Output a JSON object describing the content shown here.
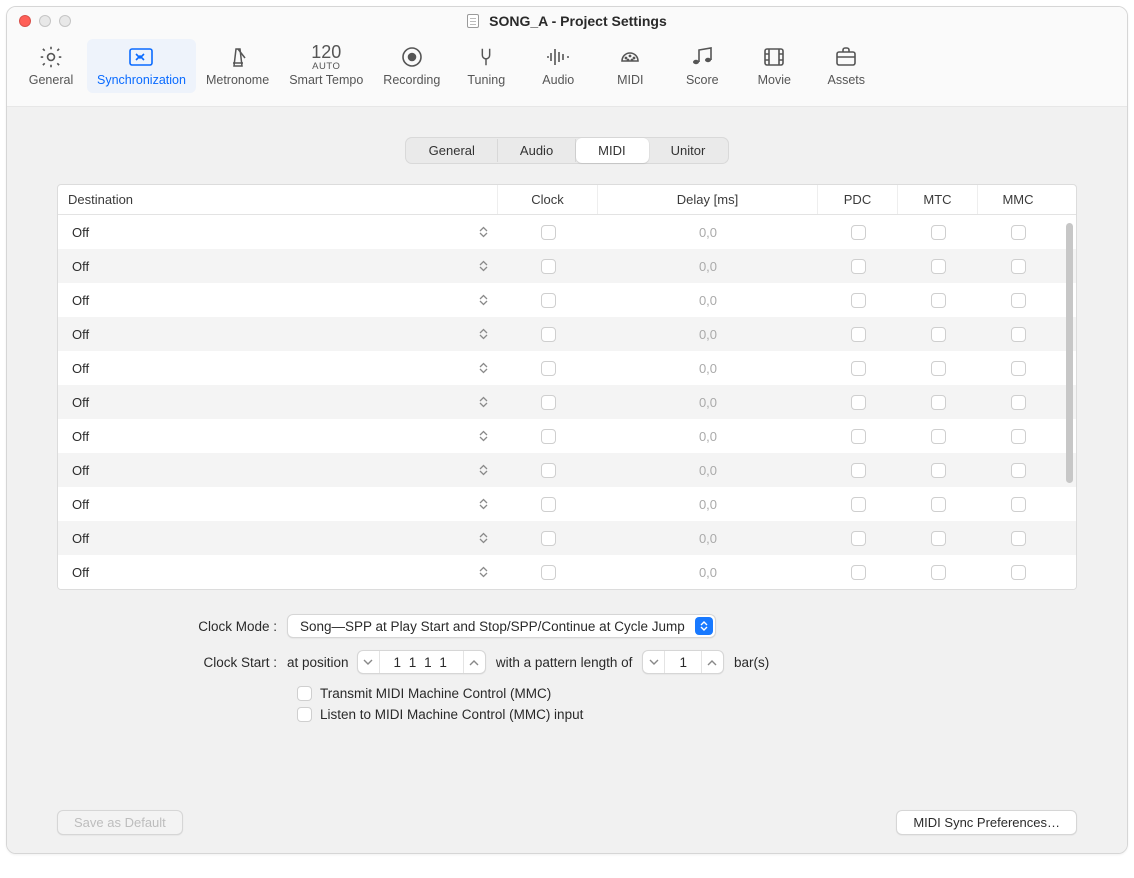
{
  "window": {
    "title": "SONG_A - Project Settings"
  },
  "toolbar": {
    "items": [
      {
        "label": "General"
      },
      {
        "label": "Synchronization"
      },
      {
        "label": "Metronome"
      },
      {
        "label": "Smart Tempo",
        "tempo_num": "120",
        "tempo_sub": "AUTO"
      },
      {
        "label": "Recording"
      },
      {
        "label": "Tuning"
      },
      {
        "label": "Audio"
      },
      {
        "label": "MIDI"
      },
      {
        "label": "Score"
      },
      {
        "label": "Movie"
      },
      {
        "label": "Assets"
      }
    ],
    "active_index": 1
  },
  "subtabs": {
    "items": [
      "General",
      "Audio",
      "MIDI",
      "Unitor"
    ],
    "active_index": 2
  },
  "table": {
    "headers": {
      "destination": "Destination",
      "clock": "Clock",
      "delay": "Delay [ms]",
      "pdc": "PDC",
      "mtc": "MTC",
      "mmc": "MMC"
    },
    "rows": [
      {
        "destination": "Off",
        "clock": false,
        "delay": "0,0",
        "pdc": false,
        "mtc": false,
        "mmc": false
      },
      {
        "destination": "Off",
        "clock": false,
        "delay": "0,0",
        "pdc": false,
        "mtc": false,
        "mmc": false
      },
      {
        "destination": "Off",
        "clock": false,
        "delay": "0,0",
        "pdc": false,
        "mtc": false,
        "mmc": false
      },
      {
        "destination": "Off",
        "clock": false,
        "delay": "0,0",
        "pdc": false,
        "mtc": false,
        "mmc": false
      },
      {
        "destination": "Off",
        "clock": false,
        "delay": "0,0",
        "pdc": false,
        "mtc": false,
        "mmc": false
      },
      {
        "destination": "Off",
        "clock": false,
        "delay": "0,0",
        "pdc": false,
        "mtc": false,
        "mmc": false
      },
      {
        "destination": "Off",
        "clock": false,
        "delay": "0,0",
        "pdc": false,
        "mtc": false,
        "mmc": false
      },
      {
        "destination": "Off",
        "clock": false,
        "delay": "0,0",
        "pdc": false,
        "mtc": false,
        "mmc": false
      },
      {
        "destination": "Off",
        "clock": false,
        "delay": "0,0",
        "pdc": false,
        "mtc": false,
        "mmc": false
      },
      {
        "destination": "Off",
        "clock": false,
        "delay": "0,0",
        "pdc": false,
        "mtc": false,
        "mmc": false
      },
      {
        "destination": "Off",
        "clock": false,
        "delay": "0,0",
        "pdc": false,
        "mtc": false,
        "mmc": false
      }
    ]
  },
  "form": {
    "clock_mode_label": "Clock Mode :",
    "clock_mode_value": "Song—SPP at Play Start and Stop/SPP/Continue at Cycle Jump",
    "clock_start_label": "Clock Start :",
    "clock_start_prefix": "at position",
    "clock_start_position": "1  1  1      1",
    "clock_start_middle": "with a pattern length of",
    "clock_start_pattern": "1",
    "clock_start_suffix": "bar(s)",
    "transmit_mmc": "Transmit MIDI Machine Control (MMC)",
    "listen_mmc": "Listen to MIDI Machine Control (MMC) input"
  },
  "footer": {
    "save_default": "Save as Default",
    "midi_prefs": "MIDI Sync Preferences…"
  }
}
